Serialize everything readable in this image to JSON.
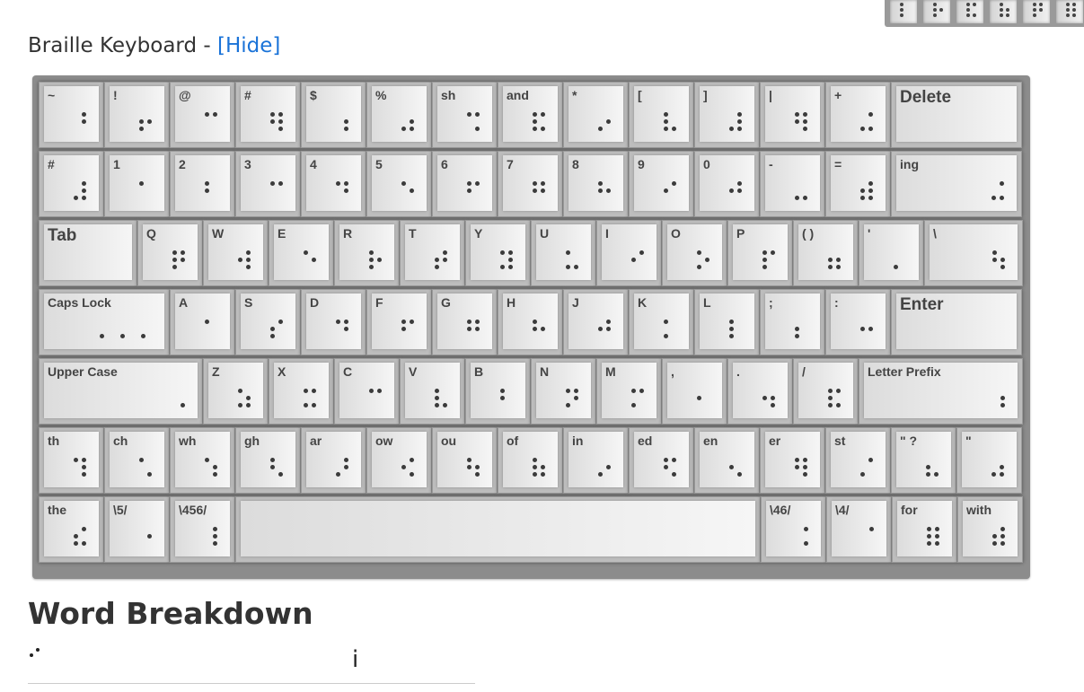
{
  "keyboard_header": {
    "title": "Braille Keyboard -",
    "toggle_link": "[Hide]"
  },
  "top_strip_cells": [
    [
      1,
      2,
      3
    ],
    [
      1,
      2,
      3,
      5
    ],
    [
      1,
      2,
      3,
      4,
      6
    ],
    [
      1,
      2,
      3,
      5,
      6
    ],
    [
      1,
      2,
      3,
      4,
      5
    ],
    [
      1,
      2,
      3,
      4,
      5,
      6
    ]
  ],
  "keys": [
    [
      {
        "label": "~",
        "dots": [
          4,
          5
        ]
      },
      {
        "label": "!",
        "dots": [
          2,
          3,
          5
        ]
      },
      {
        "label": "@",
        "dots": [
          1,
          4
        ]
      },
      {
        "label": "#",
        "dots": [
          1,
          2,
          4,
          5,
          6
        ]
      },
      {
        "label": "$",
        "dots": [
          5,
          6
        ]
      },
      {
        "label": "%",
        "dots": [
          3,
          5,
          6
        ]
      },
      {
        "label": "sh",
        "dots": [
          1,
          4,
          6
        ]
      },
      {
        "label": "and",
        "dots": [
          1,
          2,
          3,
          4,
          6
        ]
      },
      {
        "label": "*",
        "dots": [
          3,
          5
        ]
      },
      {
        "label": "[",
        "dots": [
          1,
          2,
          3,
          6
        ]
      },
      {
        "label": "]",
        "dots": [
          3,
          4,
          5,
          6
        ]
      },
      {
        "label": "|",
        "dots": [
          1,
          2,
          4,
          5,
          6
        ]
      },
      {
        "label": "+",
        "dots": [
          3,
          4,
          6
        ]
      },
      {
        "label": "Delete",
        "dots": []
      }
    ],
    [
      {
        "label": "#",
        "dots": [
          3,
          4,
          5,
          6
        ]
      },
      {
        "label": "1",
        "dots": [
          1
        ]
      },
      {
        "label": "2",
        "dots": [
          1,
          2
        ]
      },
      {
        "label": "3",
        "dots": [
          1,
          4
        ]
      },
      {
        "label": "4",
        "dots": [
          1,
          4,
          5
        ]
      },
      {
        "label": "5",
        "dots": [
          1,
          5
        ]
      },
      {
        "label": "6",
        "dots": [
          1,
          2,
          4
        ]
      },
      {
        "label": "7",
        "dots": [
          1,
          2,
          4,
          5
        ]
      },
      {
        "label": "8",
        "dots": [
          1,
          2,
          5
        ]
      },
      {
        "label": "9",
        "dots": [
          2,
          4
        ]
      },
      {
        "label": "0",
        "dots": [
          2,
          4,
          5
        ]
      },
      {
        "label": "-",
        "dots": [
          3,
          6
        ]
      },
      {
        "label": "=",
        "dots": [
          2,
          3,
          4,
          5,
          6
        ]
      },
      {
        "label": "ing",
        "dots": [
          3,
          4,
          6
        ]
      }
    ],
    [
      {
        "label": "Tab",
        "dots": []
      },
      {
        "label": "Q",
        "dots": [
          1,
          2,
          3,
          4,
          5
        ]
      },
      {
        "label": "W",
        "dots": [
          2,
          4,
          5,
          6
        ]
      },
      {
        "label": "E",
        "dots": [
          1,
          5
        ]
      },
      {
        "label": "R",
        "dots": [
          1,
          2,
          3,
          5
        ]
      },
      {
        "label": "T",
        "dots": [
          2,
          3,
          4,
          5
        ]
      },
      {
        "label": "Y",
        "dots": [
          1,
          3,
          4,
          5,
          6
        ]
      },
      {
        "label": "U",
        "dots": [
          1,
          3,
          6
        ]
      },
      {
        "label": "I",
        "dots": [
          2,
          4
        ]
      },
      {
        "label": "O",
        "dots": [
          1,
          3,
          5
        ]
      },
      {
        "label": "P",
        "dots": [
          1,
          2,
          3,
          4
        ]
      },
      {
        "label": "( )",
        "dots": [
          2,
          3,
          5,
          6
        ]
      },
      {
        "label": "'",
        "dots": [
          3
        ]
      },
      {
        "label": "\\",
        "dots": [
          1,
          2,
          5,
          6
        ]
      }
    ],
    [
      {
        "label": "Caps Lock",
        "dots": [
          6,
          6,
          6
        ]
      },
      {
        "label": "A",
        "dots": [
          1
        ]
      },
      {
        "label": "S",
        "dots": [
          2,
          3,
          4
        ]
      },
      {
        "label": "D",
        "dots": [
          1,
          4,
          5
        ]
      },
      {
        "label": "F",
        "dots": [
          1,
          2,
          4
        ]
      },
      {
        "label": "G",
        "dots": [
          1,
          2,
          4,
          5
        ]
      },
      {
        "label": "H",
        "dots": [
          1,
          2,
          5
        ]
      },
      {
        "label": "J",
        "dots": [
          2,
          4,
          5
        ]
      },
      {
        "label": "K",
        "dots": [
          1,
          3
        ]
      },
      {
        "label": "L",
        "dots": [
          1,
          2,
          3
        ]
      },
      {
        "label": ";",
        "dots": [
          2,
          3
        ]
      },
      {
        "label": ":",
        "dots": [
          2,
          5
        ]
      },
      {
        "label": "Enter",
        "dots": []
      }
    ],
    [
      {
        "label": "Upper Case",
        "dots": [
          6
        ]
      },
      {
        "label": "Z",
        "dots": [
          1,
          3,
          5,
          6
        ]
      },
      {
        "label": "X",
        "dots": [
          1,
          3,
          4,
          6
        ]
      },
      {
        "label": "C",
        "dots": [
          1,
          4
        ]
      },
      {
        "label": "V",
        "dots": [
          1,
          2,
          3,
          6
        ]
      },
      {
        "label": "B",
        "dots": [
          1,
          2
        ]
      },
      {
        "label": "N",
        "dots": [
          1,
          3,
          4,
          5
        ]
      },
      {
        "label": "M",
        "dots": [
          1,
          3,
          4
        ]
      },
      {
        "label": ",",
        "dots": [
          2
        ]
      },
      {
        "label": ".",
        "dots": [
          2,
          5,
          6
        ]
      },
      {
        "label": "/",
        "dots": [
          1,
          2,
          3,
          4,
          6
        ]
      },
      {
        "label": "Letter Prefix",
        "dots": [
          5,
          6
        ]
      }
    ],
    [
      {
        "label": "th",
        "dots": [
          1,
          4,
          5,
          6
        ]
      },
      {
        "label": "ch",
        "dots": [
          1,
          6
        ]
      },
      {
        "label": "wh",
        "dots": [
          1,
          5,
          6
        ]
      },
      {
        "label": "gh",
        "dots": [
          1,
          2,
          6
        ]
      },
      {
        "label": "ar",
        "dots": [
          3,
          4,
          5
        ]
      },
      {
        "label": "ow",
        "dots": [
          2,
          4,
          6
        ]
      },
      {
        "label": "ou",
        "dots": [
          1,
          2,
          5,
          6
        ]
      },
      {
        "label": "of",
        "dots": [
          1,
          2,
          3,
          5,
          6
        ]
      },
      {
        "label": "in",
        "dots": [
          3,
          5
        ]
      },
      {
        "label": "ed",
        "dots": [
          1,
          2,
          4,
          6
        ]
      },
      {
        "label": "en",
        "dots": [
          2,
          6
        ]
      },
      {
        "label": "er",
        "dots": [
          1,
          2,
          4,
          5,
          6
        ]
      },
      {
        "label": "st",
        "dots": [
          3,
          4
        ]
      },
      {
        "label": "\" ?",
        "dots": [
          2,
          3,
          6
        ]
      },
      {
        "label": "\"",
        "dots": [
          3,
          5,
          6
        ]
      }
    ],
    [
      {
        "label": "the",
        "dots": [
          2,
          3,
          4,
          6
        ]
      },
      {
        "label": "\\5/",
        "dots": [
          5
        ]
      },
      {
        "label": "\\456/",
        "dots": [
          4,
          5,
          6
        ]
      },
      {
        "label": "",
        "dots": []
      },
      {
        "label": "\\46/",
        "dots": [
          4,
          6
        ]
      },
      {
        "label": "\\4/",
        "dots": [
          4
        ]
      },
      {
        "label": "for",
        "dots": [
          1,
          2,
          3,
          4,
          5,
          6
        ]
      },
      {
        "label": "with",
        "dots": [
          2,
          3,
          4,
          5,
          6
        ]
      }
    ]
  ],
  "word_breakdown": {
    "title": "Word Breakdown",
    "braille_dots": [
      2,
      4
    ],
    "text": "i"
  }
}
